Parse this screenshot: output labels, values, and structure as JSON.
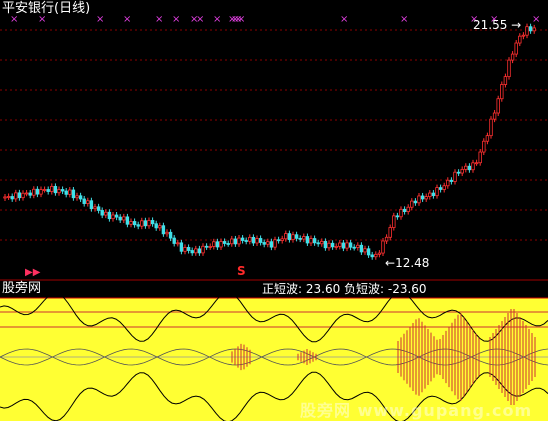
{
  "window": {
    "title": "平安银行(日线)"
  },
  "main_chart": {
    "price_high_label": "21.55",
    "price_low_label": "12.48",
    "signal_marker": "S",
    "play_icon": "play-icon"
  },
  "sub_chart": {
    "indicator_name": "股旁网",
    "wave_text": "正短波: 23.60  负短波: -23.60"
  },
  "watermark": "股旁网  www.gupang.com",
  "colors": {
    "background": "#000000",
    "bull": "#ff3030",
    "bear": "#40e0e8",
    "grid": "#8b0000",
    "indicator_bg": "#ffff33",
    "signal_x": "#e040e0"
  },
  "chart_data": {
    "type": "candlestick",
    "title": "平安银行(日线)",
    "price_range": [
      12.48,
      21.55
    ],
    "max_label": 21.55,
    "min_label": 12.48,
    "indicator": {
      "positive_short_wave": 23.6,
      "negative_short_wave": -23.6
    }
  }
}
